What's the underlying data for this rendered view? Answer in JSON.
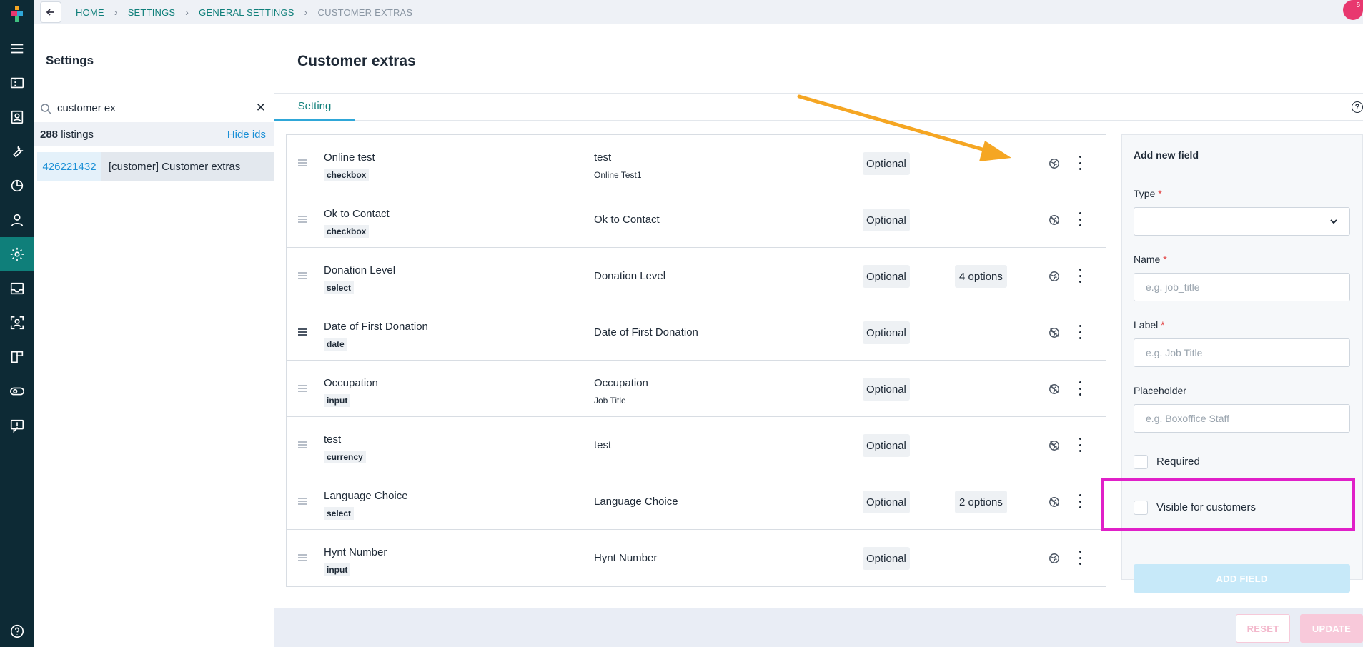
{
  "breadcrumb": {
    "items": [
      "HOME",
      "SETTINGS",
      "GENERAL SETTINGS",
      "CUSTOMER EXTRAS"
    ]
  },
  "notification": {
    "count": "6"
  },
  "sidebar": {
    "title": "Settings",
    "search_value": "customer ex",
    "listings_count": "288",
    "listings_label": "listings",
    "hide_ids_label": "Hide ids",
    "items": [
      {
        "id": "426221432",
        "name": "[customer] Customer extras"
      }
    ]
  },
  "rail": {
    "icons": [
      "logo-icon",
      "menu-icon",
      "ticket-icon",
      "contact-card-icon",
      "wrench-icon",
      "chart-icon",
      "user-icon",
      "settings-gear-icon",
      "inbox-icon",
      "scan-user-icon",
      "board-icon",
      "toggle-icon",
      "feedback-icon",
      "help-icon"
    ],
    "active": "settings-gear-icon"
  },
  "main": {
    "title": "Customer extras",
    "tab": "Setting"
  },
  "fields": [
    {
      "name": "Online test",
      "type": "checkbox",
      "label": "test",
      "sublabel": "Online Test1",
      "required": "Optional",
      "options": "",
      "visible": true
    },
    {
      "name": "Ok to Contact",
      "type": "checkbox",
      "label": "Ok to Contact",
      "sublabel": "",
      "required": "Optional",
      "options": "",
      "visible": false
    },
    {
      "name": "Donation Level",
      "type": "select",
      "label": "Donation Level",
      "sublabel": "",
      "required": "Optional",
      "options": "4 options",
      "visible": true
    },
    {
      "name": "Date of First Donation",
      "type": "date",
      "label": "Date of First Donation",
      "sublabel": "",
      "required": "Optional",
      "options": "",
      "visible": false
    },
    {
      "name": "Occupation",
      "type": "input",
      "label": "Occupation",
      "sublabel": "Job Title",
      "required": "Optional",
      "options": "",
      "visible": false
    },
    {
      "name": "test",
      "type": "currency",
      "label": "test",
      "sublabel": "",
      "required": "Optional",
      "options": "",
      "visible": false
    },
    {
      "name": "Language Choice",
      "type": "select",
      "label": "Language Choice",
      "sublabel": "",
      "required": "Optional",
      "options": "2 options",
      "visible": false
    },
    {
      "name": "Hynt Number",
      "type": "input",
      "label": "Hynt Number",
      "sublabel": "",
      "required": "Optional",
      "options": "",
      "visible": true
    }
  ],
  "form": {
    "title": "Add new field",
    "type_label": "Type",
    "name_label": "Name",
    "name_placeholder": "e.g. job_title",
    "label_label": "Label",
    "label_placeholder": "e.g. Job Title",
    "placeholder_label": "Placeholder",
    "placeholder_placeholder": "e.g. Boxoffice Staff",
    "required_label": "Required",
    "visible_label": "Visible for customers",
    "add_button": "ADD FIELD",
    "required_marker": "*"
  },
  "footer": {
    "reset": "RESET",
    "update": "UPDATE"
  },
  "colors": {
    "rail_bg": "#0d2a35",
    "accent": "#0f7f7a",
    "link": "#1a8fd6",
    "annotation_arrow": "#f5a623",
    "annotation_box": "#e020c8"
  }
}
